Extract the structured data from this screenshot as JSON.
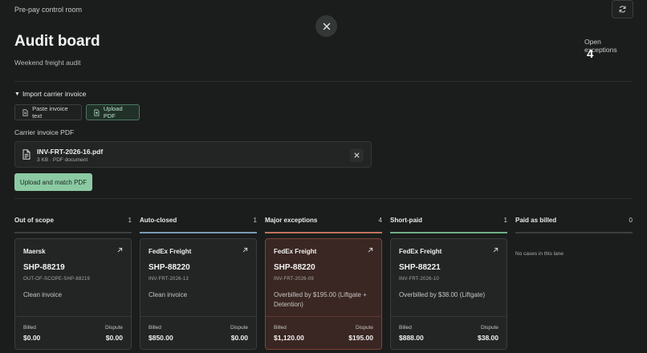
{
  "header": {
    "eyebrow": "Pre-pay control room",
    "title": "Audit board",
    "subtitle": "Weekend freight audit",
    "open_exceptions_label": "Open exceptions",
    "open_exceptions_count": "4"
  },
  "import": {
    "toggle_label": "Import carrier invoice",
    "paste_label": "Paste invoice text",
    "upload_label": "Upload PDF",
    "active_mode": "upload",
    "field_label": "Carrier invoice PDF",
    "file_name": "INV-FRT-2026-16.pdf",
    "file_meta": "3 KB · PDF document",
    "submit_label": "Upload and match PDF"
  },
  "lanes": [
    {
      "title": "Out of scope",
      "count": "1",
      "accent": "#3b3f3e"
    },
    {
      "title": "Auto-closed",
      "count": "1",
      "accent": "#7a9bb5"
    },
    {
      "title": "Major exceptions",
      "count": "4",
      "accent": "#c0735e"
    },
    {
      "title": "Short-paid",
      "count": "1",
      "accent": "#6fae86"
    },
    {
      "title": "Paid as billed",
      "count": "0",
      "accent": "#3b3f3e"
    }
  ],
  "cards": [
    {
      "carrier": "Maersk",
      "shipment": "SHP-88219",
      "reference": "OUT-OF-SCOPE-SHP-88219",
      "note": "Clean invoice",
      "billed_label": "Billed",
      "billed": "$0.00",
      "dispute_label": "Dispute",
      "dispute": "$0.00",
      "alert": false
    },
    {
      "carrier": "FedEx Freight",
      "shipment": "SHP-88220",
      "reference": "INV-FRT-2026-13",
      "note": "Clean invoice",
      "billed_label": "Billed",
      "billed": "$850.00",
      "dispute_label": "Dispute",
      "dispute": "$0.00",
      "alert": false
    },
    {
      "carrier": "FedEx Freight",
      "shipment": "SHP-88220",
      "reference": "INV-FRT-2026-09",
      "note": "Overbilled by $195.00 (Liftgate + Detention)",
      "billed_label": "Billed",
      "billed": "$1,120.00",
      "dispute_label": "Dispute",
      "dispute": "$195.00",
      "alert": true
    },
    {
      "carrier": "FedEx Freight",
      "shipment": "SHP-88221",
      "reference": "INV-FRT-2026-10",
      "note": "Overbilled by $38.00 (Liftgate)",
      "billed_label": "Billed",
      "billed": "$888.00",
      "dispute_label": "Dispute",
      "dispute": "$38.00",
      "alert": false
    }
  ],
  "empty_lane_text": "No cases in this lane",
  "icons": {
    "refresh": "refresh-icon",
    "close": "close-icon",
    "document": "document-icon",
    "upload": "upload-file-icon",
    "remove": "remove-icon",
    "open": "open-external-icon"
  }
}
